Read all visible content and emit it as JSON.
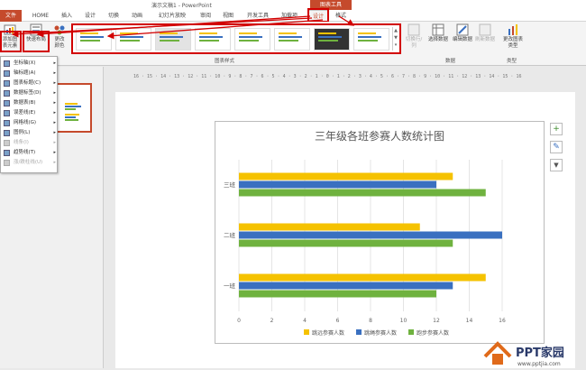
{
  "window": {
    "title": "演示文稿1 - PowerPoint",
    "contextual_header": "图表工具"
  },
  "tabs": [
    {
      "label": "文件"
    },
    {
      "label": "HOME"
    },
    {
      "label": "插入"
    },
    {
      "label": "设计"
    },
    {
      "label": "切换"
    },
    {
      "label": "动画"
    },
    {
      "label": "幻灯片放映"
    },
    {
      "label": "审阅"
    },
    {
      "label": "视图"
    },
    {
      "label": "开发工具"
    },
    {
      "label": "加载项"
    },
    {
      "label": "设计"
    },
    {
      "label": "格式"
    }
  ],
  "ribbon": {
    "add_element": "添加图表元素",
    "quick_layout": "快速布局",
    "change_colors": "更改颜色",
    "styles_group": "图表样式",
    "switch_row_col": "切换行/列",
    "select_data": "选择数据",
    "edit_data": "编辑数据",
    "refresh_data": "刷新数据",
    "data_group": "数据",
    "change_chart_type": "更改图表类型",
    "type_group": "类型"
  },
  "menu": {
    "items": [
      {
        "label": "坐标轴(X)",
        "disabled": false
      },
      {
        "label": "轴标题(A)",
        "disabled": false
      },
      {
        "label": "图表标题(C)",
        "disabled": false
      },
      {
        "label": "数据标签(D)",
        "disabled": false
      },
      {
        "label": "数据表(B)",
        "disabled": false
      },
      {
        "label": "误差线(E)",
        "disabled": false
      },
      {
        "label": "网格线(G)",
        "disabled": false
      },
      {
        "label": "图例(L)",
        "disabled": false
      },
      {
        "label": "线条(I)",
        "disabled": true
      },
      {
        "label": "趋势线(T)",
        "disabled": false
      },
      {
        "label": "涨/跌柱线(U)",
        "disabled": true
      }
    ]
  },
  "ruler": {
    "horizontal": "16 · 15 · 14 · 13 · 12 · 11 · 10 · 9 · 8 · 7 · 6 · 5 · 4 · 3 · 2 · 1 · 0 · 1 · 2 · 3 · 4 · 5 · 6 · 7 · 8 · 9 · 10 · 11 · 12 · 13 · 14 · 15 · 16"
  },
  "chart_side_buttons": [
    "+",
    "✎",
    "▼"
  ],
  "colors": {
    "accent": "#c54a2c",
    "annotation_red": "#d20000",
    "series1": "#f5c200",
    "series2": "#3a70c0",
    "series3": "#6fb23f"
  },
  "watermark": {
    "brand": "PPT家园",
    "url": "www.pptjia.com"
  },
  "chart_data": {
    "type": "bar",
    "orientation": "horizontal",
    "title": "三年级各班参赛人数统计图",
    "categories": [
      "一班",
      "二班",
      "三班"
    ],
    "series": [
      {
        "name": "跳远参赛人数",
        "color": "#f5c200",
        "values": [
          15,
          11,
          13
        ]
      },
      {
        "name": "跳绳参赛人数",
        "color": "#3a70c0",
        "values": [
          13,
          16,
          12
        ]
      },
      {
        "name": "跑步参赛人数",
        "color": "#6fb23f",
        "values": [
          12,
          13,
          15
        ]
      }
    ],
    "xlim": [
      0,
      16
    ],
    "xticks": [
      0,
      2,
      4,
      6,
      8,
      10,
      12,
      14,
      16
    ],
    "grid": true,
    "legend": "bottom"
  }
}
